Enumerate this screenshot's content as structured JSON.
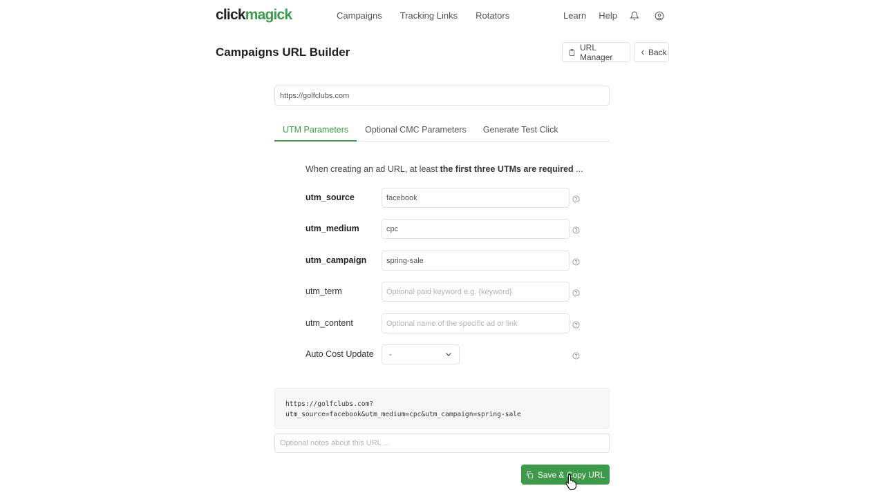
{
  "header": {
    "logo_part1": "click",
    "logo_part2": "magick",
    "nav": [
      "Campaigns",
      "Tracking Links",
      "Rotators"
    ],
    "learn": "Learn",
    "help": "Help"
  },
  "page": {
    "title": "Campaigns URL Builder",
    "url_manager_label": "URL Manager",
    "back_label": "Back"
  },
  "base_url": "https://golfclubs.com",
  "tabs": [
    "UTM Parameters",
    "Optional CMC Parameters",
    "Generate Test Click"
  ],
  "active_tab": 0,
  "intro": {
    "text": "When creating an ad URL, at least ",
    "bold": "the first three UTMs are required",
    "tail": " ..."
  },
  "fields": {
    "utm_source": {
      "label": "utm_source",
      "value": "facebook"
    },
    "utm_medium": {
      "label": "utm_medium",
      "value": "cpc"
    },
    "utm_campaign": {
      "label": "utm_campaign",
      "value": "spring-sale"
    },
    "utm_term": {
      "label": "utm_term",
      "placeholder": "Optional paid keyword e.g. {keyword}"
    },
    "utm_content": {
      "label": "utm_content",
      "placeholder": "Optional name of the specific ad or link"
    },
    "auto_cost": {
      "label": "Auto Cost Update",
      "value": "-"
    }
  },
  "output": {
    "line1": "https://golfclubs.com?",
    "line2": "utm_source=facebook&utm_medium=cpc&utm_campaign=spring-sale"
  },
  "notes_placeholder": "Optional notes about this URL ...",
  "save_label": "Save & Copy URL",
  "colors": {
    "accent": "#3d9a4a"
  }
}
